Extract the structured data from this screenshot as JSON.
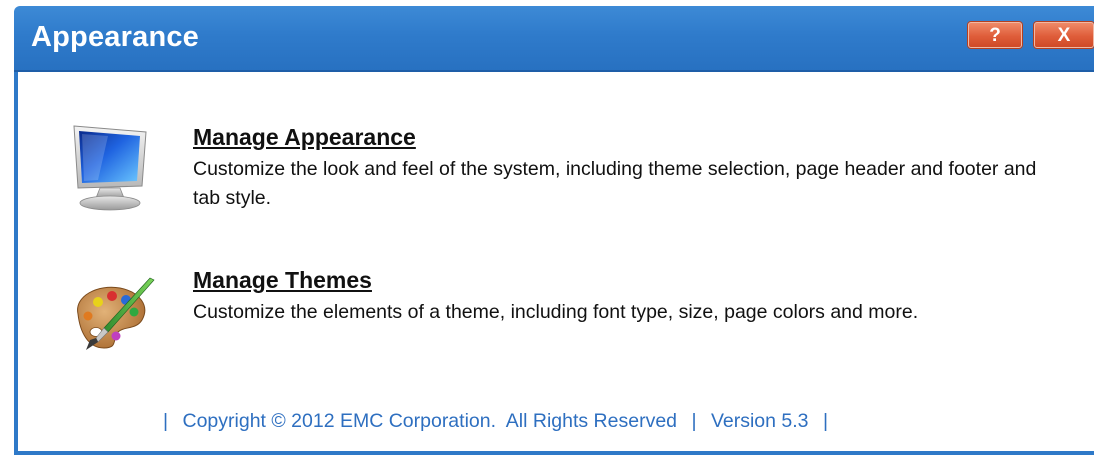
{
  "window": {
    "title": "Appearance",
    "help_label": "?",
    "close_label": "X"
  },
  "items": [
    {
      "title": "Manage Appearance",
      "description": "Customize the look and feel of the system, including theme selection, page header and footer and tab style.",
      "icon": "monitor-icon"
    },
    {
      "title": "Manage Themes",
      "description": "Customize the elements of a theme, including font type, size, page colors and more.",
      "icon": "paint-palette-icon"
    }
  ],
  "footer": {
    "separator": "|",
    "copyright": "Copyright © 2012 EMC Corporation.  All Rights Reserved",
    "version": "Version 5.3"
  },
  "colors": {
    "titlebar": "#2f7bcb",
    "title_button": "#df5d3a",
    "footer_text": "#2e6fc0"
  }
}
